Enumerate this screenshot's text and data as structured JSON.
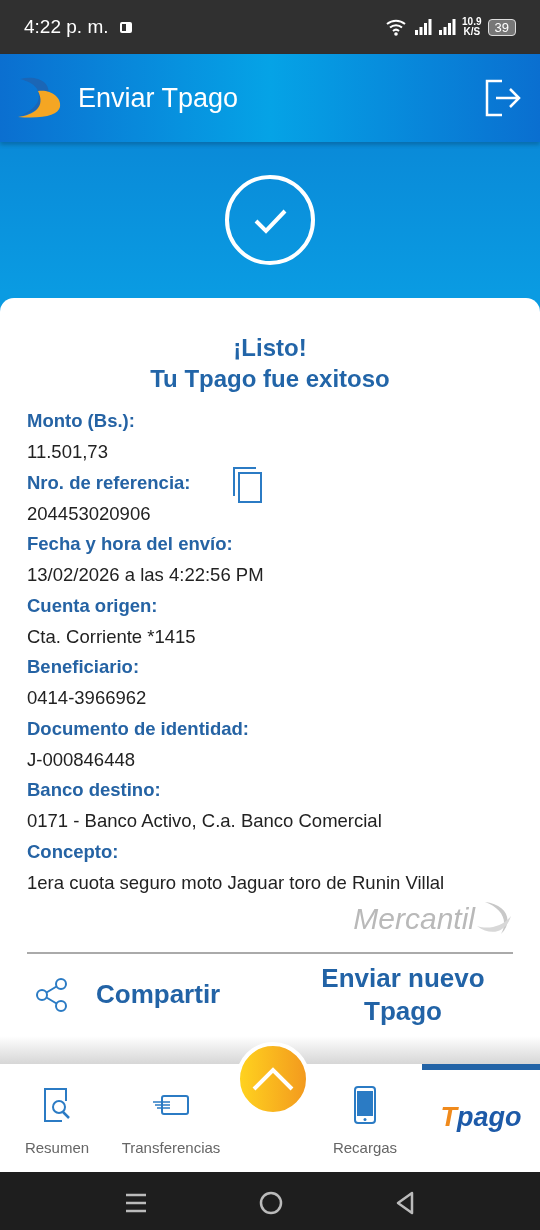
{
  "status_bar": {
    "time": "4:22 p. m.",
    "speed": "10.9",
    "speed_unit": "K/S",
    "battery": "39"
  },
  "header": {
    "title": "Enviar Tpago"
  },
  "receipt": {
    "title": "¡Listo!",
    "subtitle": "Tu Tpago fue exitoso",
    "fields": [
      {
        "label": "Monto (Bs.):",
        "value": "11.501,73",
        "kind": "text"
      },
      {
        "label": "Nro. de referencia:",
        "value": "204453020906",
        "kind": "copyable"
      },
      {
        "label": "Fecha y hora del envío:",
        "value": "13/02/2026 a las 4:22:56 PM",
        "kind": "text"
      },
      {
        "label": "Cuenta origen:",
        "value": "Cta. Corriente *1415",
        "kind": "text"
      },
      {
        "label": "Beneficiario:",
        "value": "0414-3966962",
        "kind": "text"
      },
      {
        "label": "Documento de identidad:",
        "value": "J-000846448",
        "kind": "text"
      },
      {
        "label": "Banco destino:",
        "value": "0171 - Banco Activo, C.a. Banco Comercial",
        "kind": "text"
      },
      {
        "label": "Concepto:",
        "value": "1era cuota seguro moto Jaguar toro de Runin Villal",
        "kind": "text"
      }
    ],
    "bank_logo": "Mercantil",
    "actions": [
      {
        "label": "Compartir",
        "kind": "share"
      },
      {
        "label": "Enviar nuevo Tpago",
        "kind": "plain"
      }
    ]
  },
  "bottom_nav": [
    {
      "label": "Resumen",
      "kind": "summary",
      "selected": false
    },
    {
      "label": "Transferencias",
      "kind": "transfer",
      "selected": false
    },
    {
      "label": "Recargas",
      "kind": "recharge",
      "selected": false
    },
    {
      "label": "Tpago",
      "kind": "logo",
      "selected": true
    }
  ]
}
